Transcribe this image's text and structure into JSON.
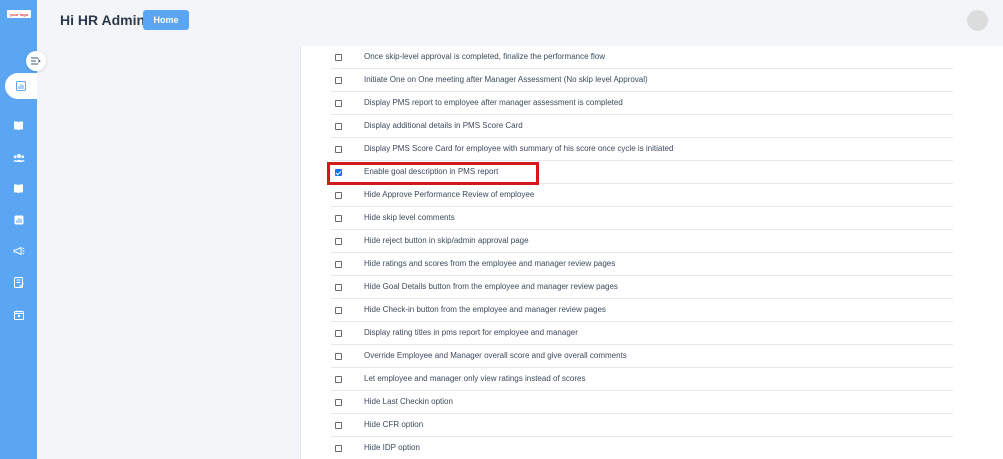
{
  "sidebar": {
    "logo_text": "your logo",
    "logo_color": "#d9383a",
    "background_color": "#5aa6f2",
    "icons": [
      "collapse-icon",
      "reports-icon",
      "book-icon",
      "users-icon",
      "book-open-icon",
      "analytics-icon",
      "megaphone-icon",
      "checklist-icon",
      "calendar-icon"
    ]
  },
  "header": {
    "greeting": "Hi HR Admin",
    "home_label": "Home"
  },
  "options": [
    {
      "label": "Once skip-level approval is completed, finalize the performance flow",
      "checked": false
    },
    {
      "label": "Initiate One on One meeting after Manager Assessment (No skip level Approval)",
      "checked": false
    },
    {
      "label": "Display PMS report to employee after manager assessment is completed",
      "checked": false
    },
    {
      "label": "Display additional details in PMS Score Card",
      "checked": false
    },
    {
      "label": "Display PMS Score Card for employee with summary of his score once cycle is initiated",
      "checked": false
    },
    {
      "label": "Enable goal description in PMS report",
      "checked": true
    },
    {
      "label": "Hide Approve Performance Review of employee",
      "checked": false
    },
    {
      "label": "Hide skip level comments",
      "checked": false
    },
    {
      "label": "Hide reject button in skip/admin approval page",
      "checked": false
    },
    {
      "label": "Hide ratings and scores from the employee and manager review pages",
      "checked": false
    },
    {
      "label": "Hide Goal Details button from the employee and manager review pages",
      "checked": false
    },
    {
      "label": "Hide Check-in button from the employee and manager review pages",
      "checked": false
    },
    {
      "label": "Display rating titles in pms report for employee and manager",
      "checked": false
    },
    {
      "label": "Override Employee and Manager overall score and give overall comments",
      "checked": false
    },
    {
      "label": "Let employee and manager only view ratings instead of scores",
      "checked": false
    },
    {
      "label": "Hide Last Checkin option",
      "checked": false
    },
    {
      "label": "Hide CFR option",
      "checked": false
    },
    {
      "label": "Hide IDP option",
      "checked": false
    }
  ],
  "colors": {
    "accent": "#5aa6f2",
    "highlight": "#d31a1a",
    "checkbox_checked": "#1a73e8"
  }
}
